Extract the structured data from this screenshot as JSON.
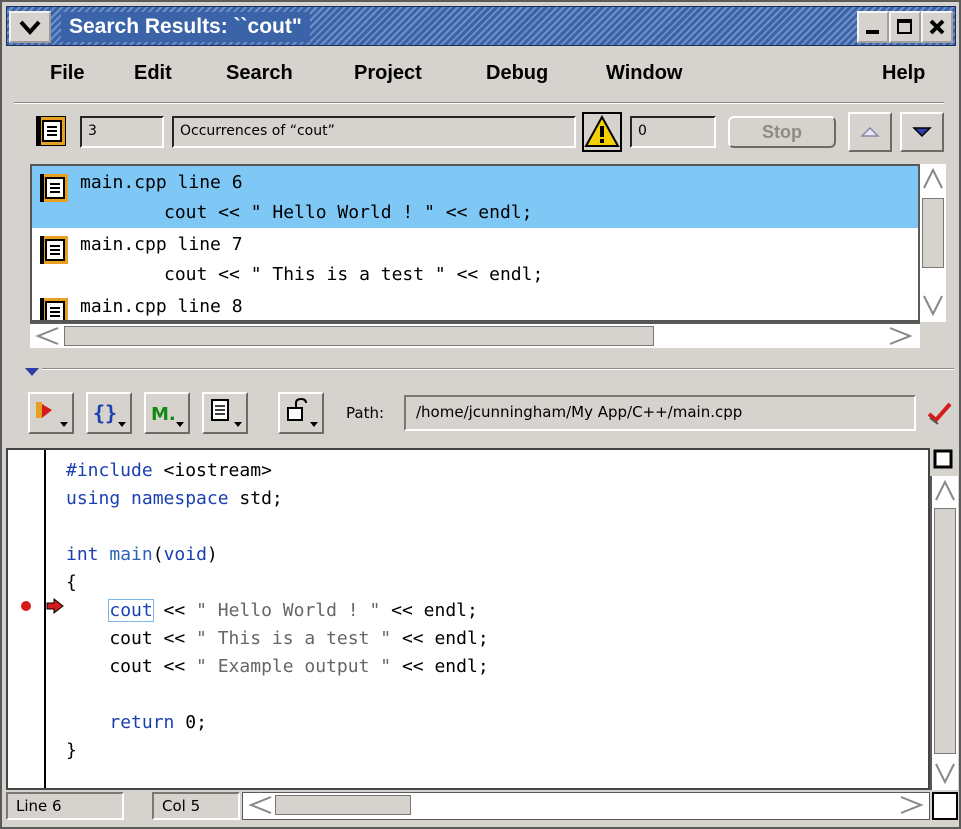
{
  "window": {
    "title": "Search Results: ``cout\"",
    "colors": {
      "titlebar": "#3b63a8",
      "selection": "#7fc8f6",
      "chrome": "#d6d3ce",
      "keyword": "#1a3fb0"
    }
  },
  "menubar": {
    "items": [
      "File",
      "Edit",
      "Search",
      "Project",
      "Debug",
      "Window",
      "Help"
    ]
  },
  "search_toolbar": {
    "count": "3",
    "description": "Occurrences of “cout”",
    "warnings": "0",
    "stop_label": "Stop",
    "icons": [
      "results-icon",
      "warning-icon",
      "prev-arrow-icon",
      "next-arrow-icon"
    ]
  },
  "results": [
    {
      "file": "main.cpp line 6",
      "code": "cout << \" Hello World ! \" << endl;",
      "selected": true
    },
    {
      "file": "main.cpp line 7",
      "code": "cout << \" This is a test \" << endl;",
      "selected": false
    },
    {
      "file": "main.cpp line 8",
      "code": "",
      "selected": false
    }
  ],
  "editor_toolbar": {
    "path_label": "Path:",
    "path_value": "/home/jcunningham/My App/C++/main.cpp",
    "buttons": [
      "bookmark-menu-icon",
      "braces-menu-icon",
      "macro-menu-icon",
      "document-menu-icon",
      "lock-menu-icon",
      "checkmark-icon"
    ]
  },
  "editor": {
    "lines": [
      "#include <iostream>",
      "using namespace std;",
      "",
      "int main(void)",
      "{",
      "    cout << \" Hello World ! \" << endl;",
      "    cout << \" This is a test \" << endl;",
      "    cout << \" Example output \" << endl;",
      "",
      "    return 0;",
      "}"
    ],
    "breakpoint_line": 6,
    "current_line": 6
  },
  "status": {
    "line": "Line 6",
    "col": "Col 5"
  }
}
